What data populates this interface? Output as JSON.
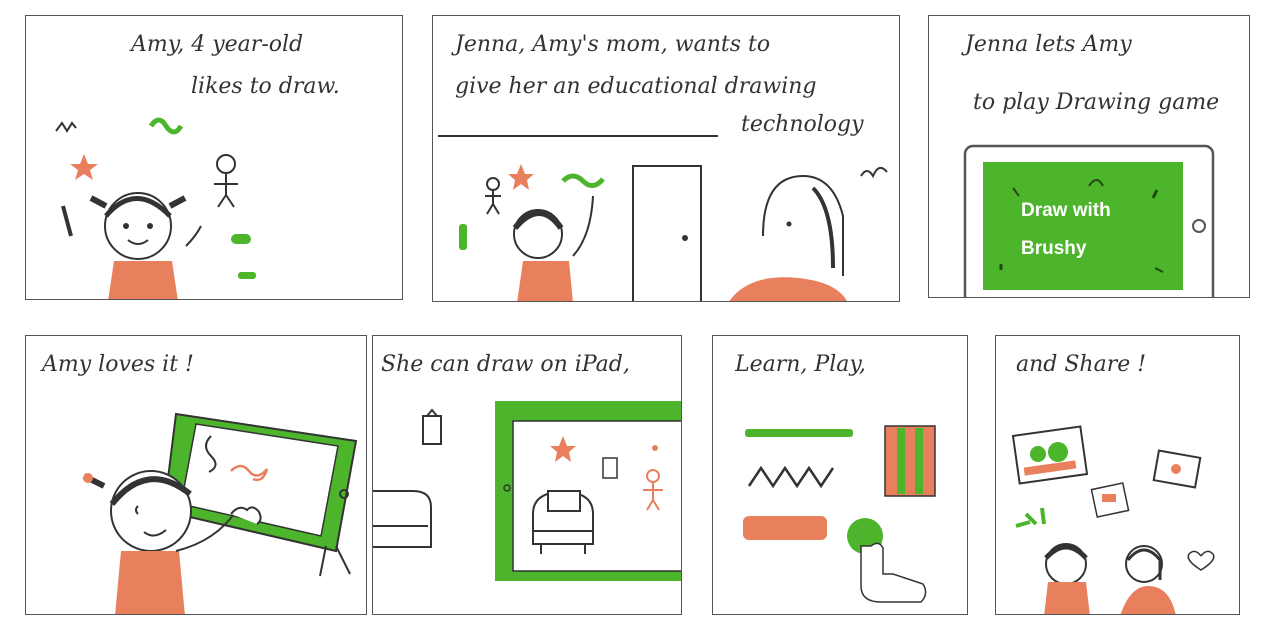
{
  "panels": [
    {
      "caption_lines": [
        "Amy, 4 year-old",
        "likes to draw."
      ]
    },
    {
      "caption_lines": [
        "Jenna, Amy's mom, wants to",
        "give her an educational drawing",
        "technology"
      ]
    },
    {
      "caption_lines": [
        "Jenna lets Amy",
        "to play Drawing game"
      ],
      "screen_lines": [
        "Draw with",
        "Brushy"
      ]
    },
    {
      "caption_lines": [
        "Amy loves it !"
      ]
    },
    {
      "caption_lines": [
        "She can draw on iPad,"
      ]
    },
    {
      "caption_lines": [
        "Learn, Play,"
      ]
    },
    {
      "caption_lines": [
        "and Share !"
      ]
    }
  ],
  "colors": {
    "accent_green": "#4db52b",
    "salmon": "#e8805e",
    "ink": "#333333"
  }
}
